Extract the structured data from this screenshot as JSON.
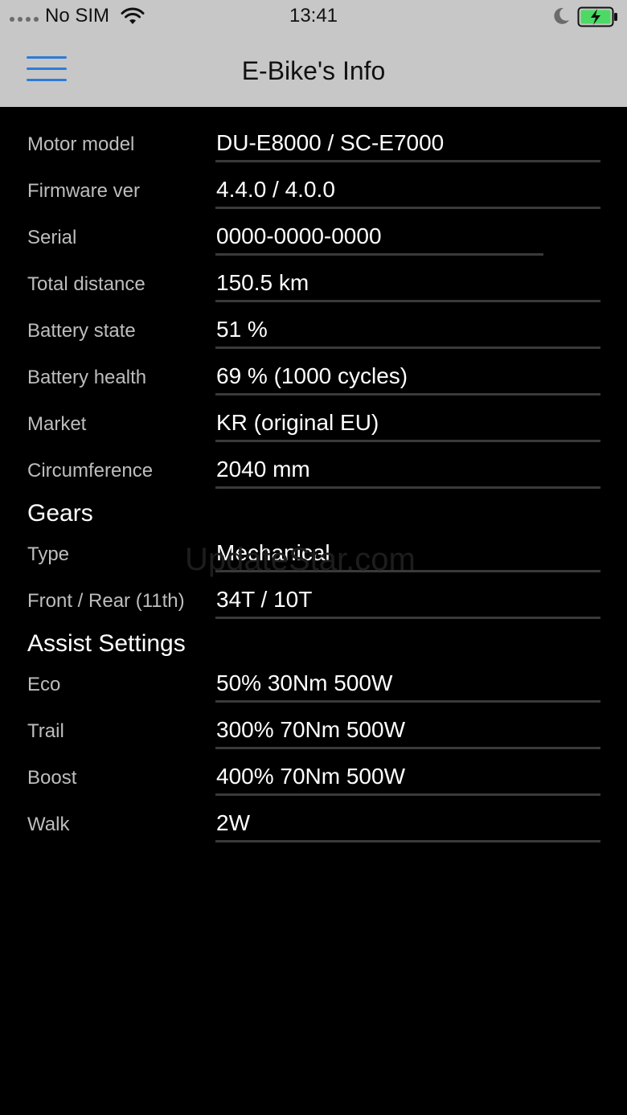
{
  "status_bar": {
    "carrier": "No SIM",
    "time": "13:41",
    "icons": [
      "signal-dots-icon",
      "wifi-icon",
      "moon-icon",
      "battery-charging-icon"
    ]
  },
  "nav": {
    "title": "E-Bike's Info",
    "menu_icon": "hamburger-menu-icon",
    "accent_color": "#2e7bd6",
    "bar_color": "#c7c7c7"
  },
  "info": {
    "rows": [
      {
        "label": "Motor model",
        "value": "DU-E8000 / SC-E7000"
      },
      {
        "label": "Firmware ver",
        "value": "4.4.0 / 4.0.0"
      },
      {
        "label": "Serial",
        "value": "0000-0000-0000"
      },
      {
        "label": "Total distance",
        "value": "150.5 km"
      },
      {
        "label": "Battery state",
        "value": "51 %"
      },
      {
        "label": "Battery health",
        "value": "69 % (1000 cycles)"
      },
      {
        "label": "Market",
        "value": "KR (original EU)"
      },
      {
        "label": "Circumference",
        "value": "2040 mm"
      }
    ]
  },
  "gears": {
    "heading": "Gears",
    "rows": [
      {
        "label": "Type",
        "value": "Mechanical"
      },
      {
        "label": "Front / Rear (11th)",
        "value": "34T / 10T"
      }
    ]
  },
  "assist": {
    "heading": "Assist Settings",
    "rows": [
      {
        "label": "Eco",
        "value": "50% 30Nm 500W"
      },
      {
        "label": "Trail",
        "value": "300% 70Nm 500W"
      },
      {
        "label": "Boost",
        "value": "400% 70Nm 500W"
      },
      {
        "label": "Walk",
        "value": "2W"
      }
    ]
  },
  "watermark": "UpdateStar.com"
}
